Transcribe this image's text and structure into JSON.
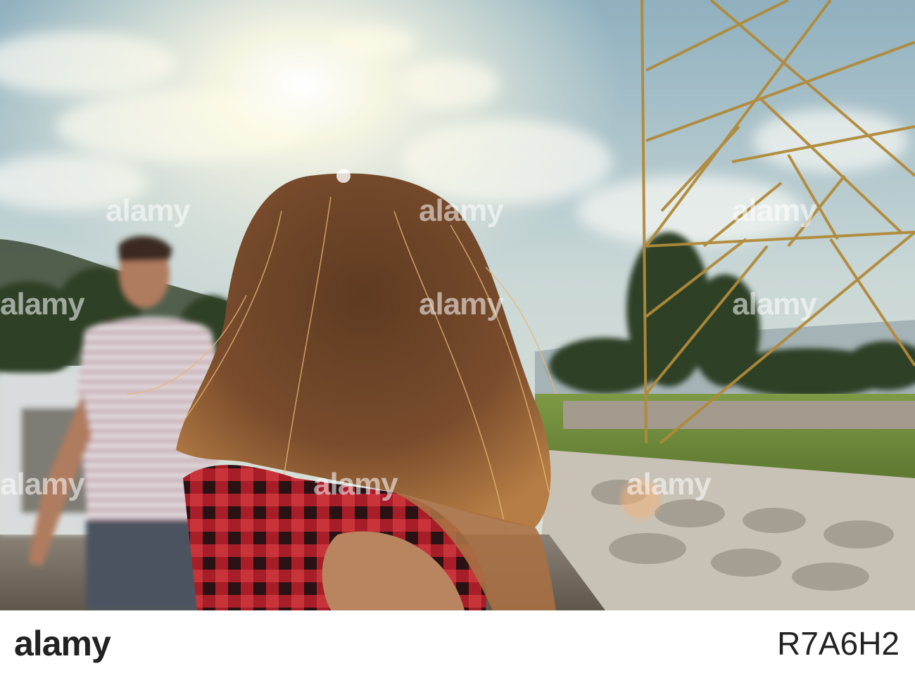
{
  "photo": {
    "watermark_text": "alamy",
    "description_colors": {
      "sky": "#b9cfd6",
      "sun": "#fffbe8",
      "hair": "#8a5a34",
      "shirt_red": "#b0202a",
      "grass": "#6d8a3a",
      "tower": "#b08a3a"
    }
  },
  "bottom_bar": {
    "logo": "alamy",
    "image_id": "R7A6H2"
  }
}
